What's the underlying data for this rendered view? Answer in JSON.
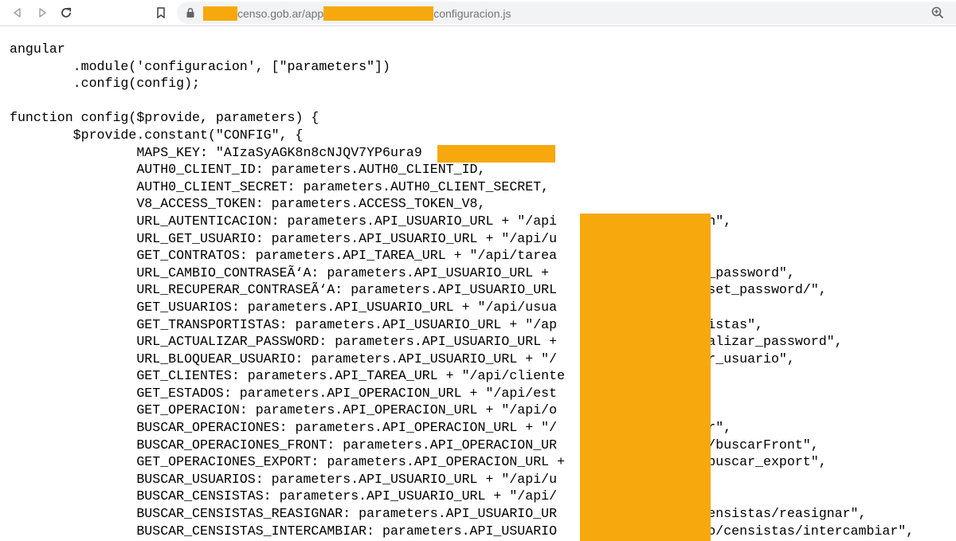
{
  "browser": {
    "url_parts": [
      "censo.gob.ar/app",
      "configuracion.js"
    ],
    "icons": {
      "back": "arrow-left-icon",
      "forward": "arrow-right-icon",
      "reload": "reload-icon",
      "bookmark": "bookmark-icon",
      "lock": "lock-icon",
      "zoom": "zoom-in-icon"
    }
  },
  "code": {
    "lines": [
      "angular",
      "        .module('configuracion', [\"parameters\"])",
      "        .config(config);",
      "",
      "function config($provide, parameters) {",
      "        $provide.constant(\"CONFIG\", {",
      "                MAPS_KEY: \"AIzaSyAGK8n8cNJQV7YP6ura9              \",",
      "                AUTH0_CLIENT_ID: parameters.AUTH0_CLIENT_ID,",
      "                AUTH0_CLIENT_SECRET: parameters.AUTH0_CLIENT_SECRET,",
      "                V8_ACCESS_TOKEN: parameters.ACCESS_TOKEN_V8,",
      "                URL_AUTENTICACION: parameters.API_USUARIO_URL + \"/api                oken\",",
      "                URL_GET_USUARIO: parameters.API_USUARIO_URL + \"/api/u",
      "                GET_CONTRATOS: parameters.API_TAREA_URL + \"/api/tarea",
      "                URL_CAMBIO_CONTRASEÃ‘A: parameters.API_USUARIO_URL +                ange_password\",",
      "                URL_RECUPERAR_CONTRASEÃ‘A: parameters.API_USUARIO_URL                /reset_password/\",",
      "                GET_USUARIOS: parameters.API_USUARIO_URL + \"/api/usua",
      "                GET_TRANSPORTISTAS: parameters.API_USUARIO_URL + \"/ap                ortistas\",",
      "                URL_ACTUALIZAR_PASSWORD: parameters.API_USUARIO_URL +                ctualizar_password\",",
      "                URL_BLOQUEAR_USUARIO: parameters.API_USUARIO_URL + \"/                uear_usuario\",",
      "                GET_CLIENTES: parameters.API_TAREA_URL + \"/api/cliente",
      "                GET_ESTADOS: parameters.API_OPERACION_URL + \"/api/est",
      "                GET_OPERACION: parameters.API_OPERACION_URL + \"/api/o",
      "                BUSCAR_OPERACIONES: parameters.API_OPERACION_URL + \"/                scar\",",
      "                BUSCAR_OPERACIONES_FRONT: parameters.API_OPERACION_UR                ion/buscarFront\",",
      "                GET_OPERACIONES_EXPORT: parameters.API_OPERACION_URL +                n/buscar_export\",",
      "                BUSCAR_USUARIOS: parameters.API_USUARIO_URL + \"/api/u",
      "                BUSCAR_CENSISTAS: parameters.API_USUARIO_URL + \"/api/                s\",",
      "                BUSCAR_CENSISTAS_REASIGNAR: parameters.API_USUARIO_UR                o/censistas/reasignar\",",
      "                BUSCAR_CENSISTAS_INTERCAMBIAR: parameters.API_USUARIO                ario/censistas/intercambiar\","
    ]
  },
  "colors": {
    "redaction": "#f7a80d",
    "omnibox": "#f1f3f4",
    "url_text": "#70757a",
    "code_text": "#000000"
  }
}
